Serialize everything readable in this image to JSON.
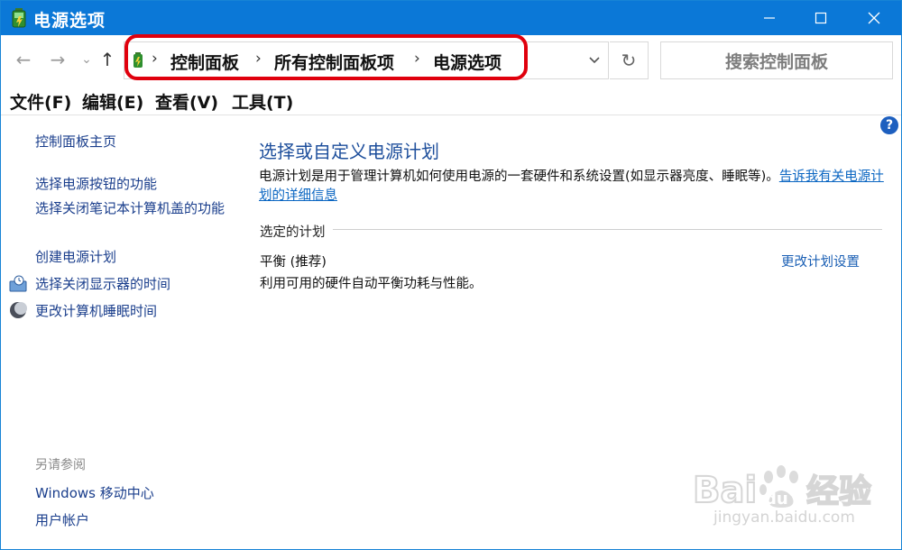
{
  "window": {
    "title": "电源选项",
    "minimize_icon": "minimize-icon",
    "maximize_icon": "maximize-icon",
    "close_icon": "close-icon",
    "accent": "#0b78d7"
  },
  "nav": {
    "back": "←",
    "forward": "→",
    "recent": "⌄",
    "up": "↑",
    "breadcrumbs": [
      "控制面板",
      "所有控制面板项",
      "电源选项"
    ],
    "separator": "›",
    "refresh": "↻",
    "search_placeholder": "搜索控制面板",
    "highlight_color": "#e0000d"
  },
  "menu": [
    "文件(F)",
    "编辑(E)",
    "查看(V)",
    "工具(T)"
  ],
  "sidebar": {
    "home": "控制面板主页",
    "links": [
      "选择电源按钮的功能",
      "选择关闭笔记本计算机盖的功能",
      "创建电源计划",
      "选择关闭显示器的时间",
      "更改计算机睡眠时间"
    ],
    "see_also_title": "另请参阅",
    "see_also": [
      "Windows 移动中心",
      "用户帐户"
    ]
  },
  "main": {
    "title": "选择或自定义电源计划",
    "description": "电源计划是用于管理计算机如何使用电源的一套硬件和系统设置(如显示器亮度、睡眠等)。",
    "description_link": "告诉我有关电源计划的详细信息",
    "section_label": "选定的计划",
    "plan_name": "平衡 (推荐)",
    "plan_description": "利用可用的硬件自动平衡功耗与性能。",
    "change_plan_link": "更改计划设置",
    "help": "?"
  },
  "watermark": {
    "logo": "Bai du 经验",
    "url": "jingyan.baidu.com"
  }
}
